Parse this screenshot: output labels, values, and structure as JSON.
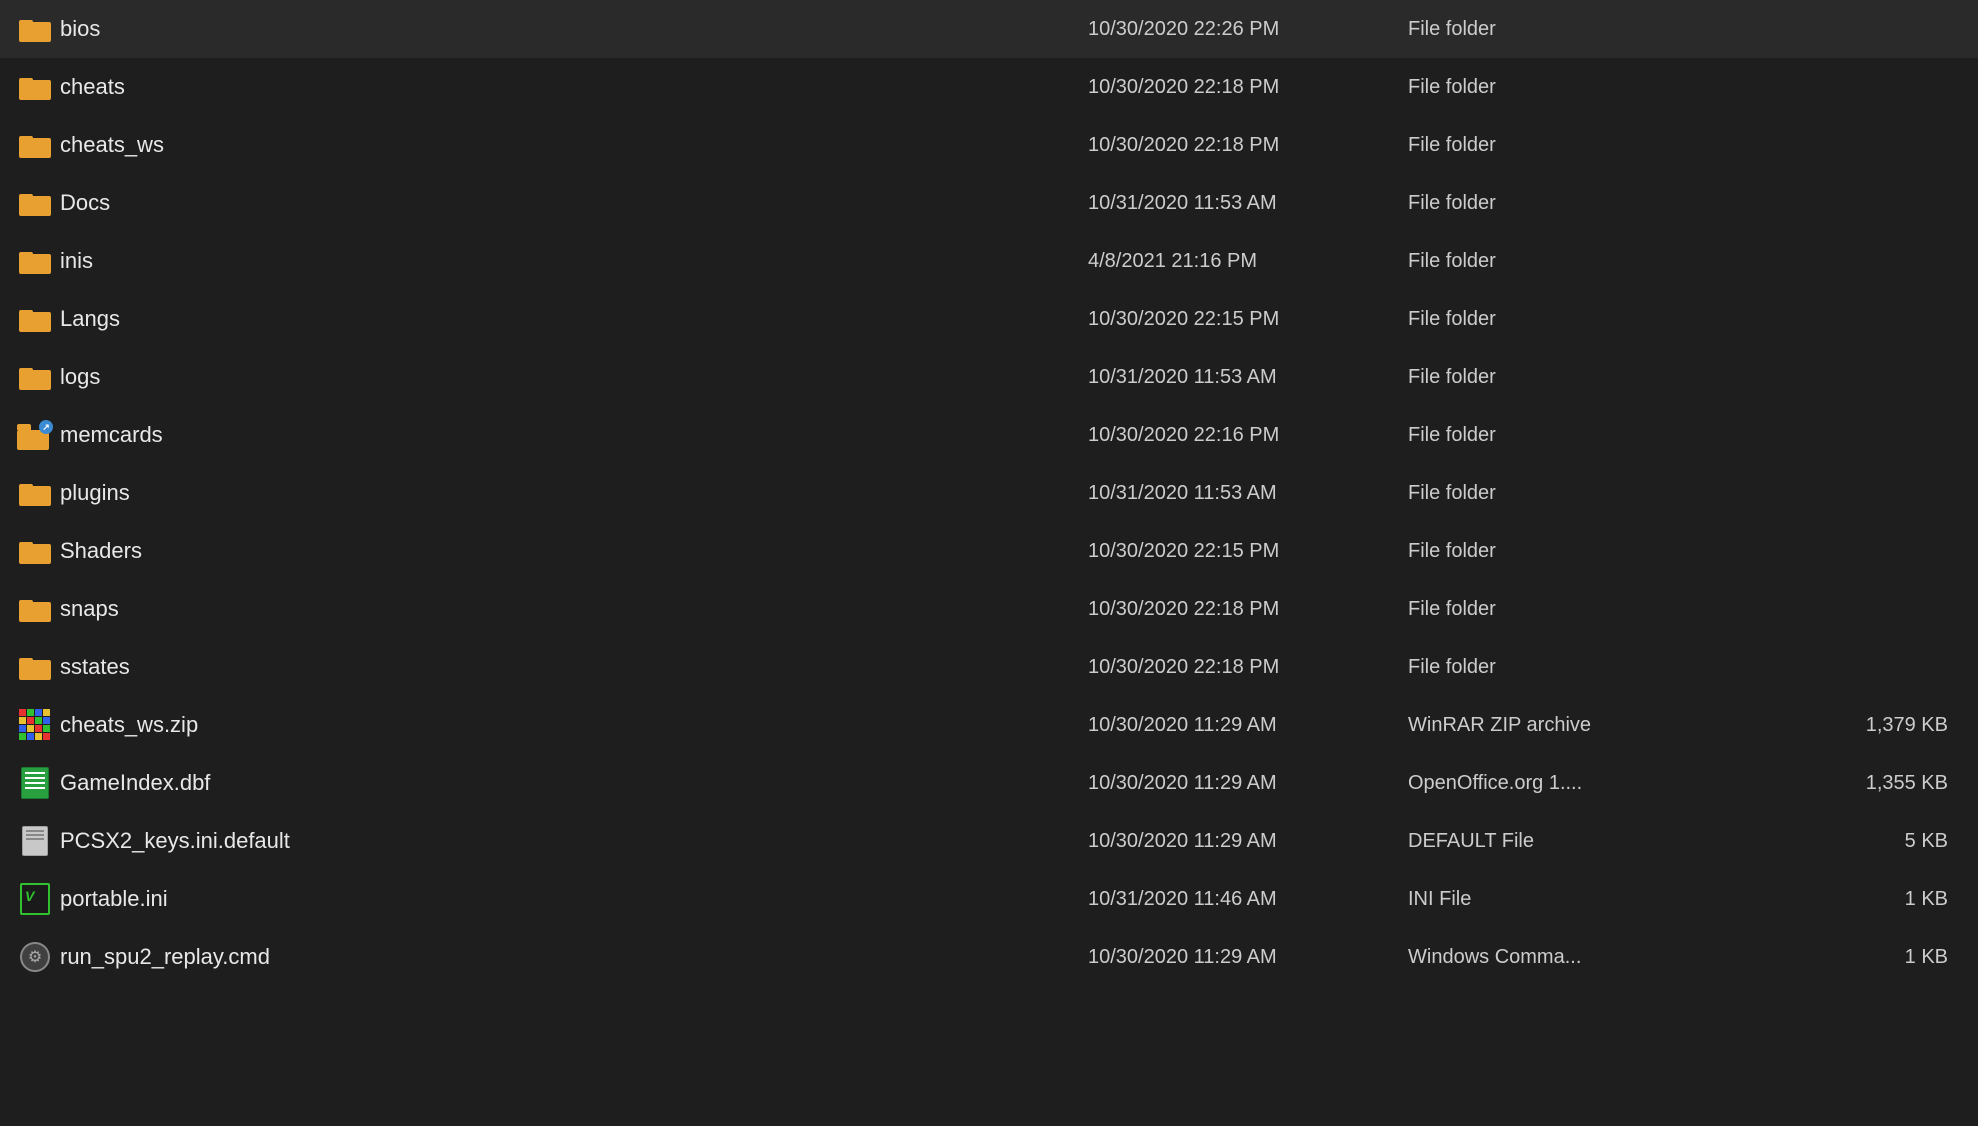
{
  "files": [
    {
      "id": "bios",
      "name": "bios",
      "date": "10/30/2020 22:26 PM",
      "type": "File folder",
      "size": "",
      "iconType": "folder"
    },
    {
      "id": "cheats",
      "name": "cheats",
      "date": "10/30/2020 22:18 PM",
      "type": "File folder",
      "size": "",
      "iconType": "folder"
    },
    {
      "id": "cheats_ws",
      "name": "cheats_ws",
      "date": "10/30/2020 22:18 PM",
      "type": "File folder",
      "size": "",
      "iconType": "folder"
    },
    {
      "id": "docs",
      "name": "Docs",
      "date": "10/31/2020 11:53 AM",
      "type": "File folder",
      "size": "",
      "iconType": "folder"
    },
    {
      "id": "inis",
      "name": "inis",
      "date": "4/8/2021 21:16 PM",
      "type": "File folder",
      "size": "",
      "iconType": "folder"
    },
    {
      "id": "langs",
      "name": "Langs",
      "date": "10/30/2020 22:15 PM",
      "type": "File folder",
      "size": "",
      "iconType": "folder"
    },
    {
      "id": "logs",
      "name": "logs",
      "date": "10/31/2020 11:53 AM",
      "type": "File folder",
      "size": "",
      "iconType": "folder"
    },
    {
      "id": "memcards",
      "name": "memcards",
      "date": "10/30/2020 22:16 PM",
      "type": "File folder",
      "size": "",
      "iconType": "folder-special"
    },
    {
      "id": "plugins",
      "name": "plugins",
      "date": "10/31/2020 11:53 AM",
      "type": "File folder",
      "size": "",
      "iconType": "folder"
    },
    {
      "id": "shaders",
      "name": "Shaders",
      "date": "10/30/2020 22:15 PM",
      "type": "File folder",
      "size": "",
      "iconType": "folder"
    },
    {
      "id": "snaps",
      "name": "snaps",
      "date": "10/30/2020 22:18 PM",
      "type": "File folder",
      "size": "",
      "iconType": "folder"
    },
    {
      "id": "sstates",
      "name": "sstates",
      "date": "10/30/2020 22:18 PM",
      "type": "File folder",
      "size": "",
      "iconType": "folder"
    },
    {
      "id": "cheats_ws_zip",
      "name": "cheats_ws.zip",
      "date": "10/30/2020 11:29 AM",
      "type": "WinRAR ZIP archive",
      "size": "1,379 KB",
      "iconType": "zip"
    },
    {
      "id": "gameindex_dbf",
      "name": "GameIndex.dbf",
      "date": "10/30/2020 11:29 AM",
      "type": "OpenOffice.org 1....",
      "size": "1,355 KB",
      "iconType": "dbf"
    },
    {
      "id": "pcsx2_keys",
      "name": "PCSX2_keys.ini.default",
      "date": "10/30/2020 11:29 AM",
      "type": "DEFAULT File",
      "size": "5 KB",
      "iconType": "default"
    },
    {
      "id": "portable_ini",
      "name": "portable.ini",
      "date": "10/31/2020 11:46 AM",
      "type": "INI File",
      "size": "1 KB",
      "iconType": "ini"
    },
    {
      "id": "run_spu2",
      "name": "run_spu2_replay.cmd",
      "date": "10/30/2020 11:29 AM",
      "type": "Windows Comma...",
      "size": "1 KB",
      "iconType": "cmd"
    }
  ]
}
